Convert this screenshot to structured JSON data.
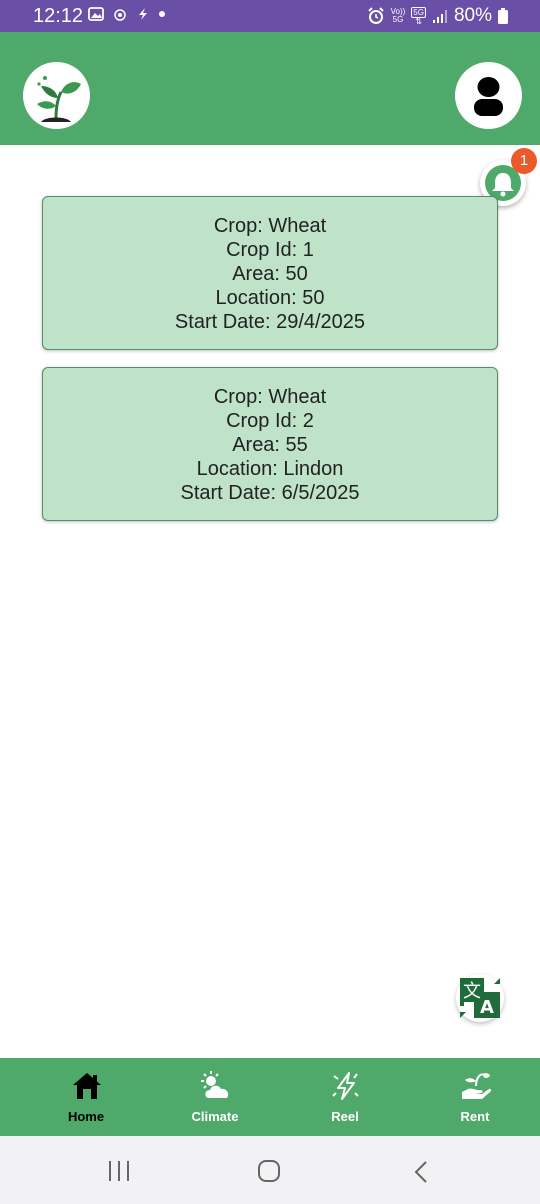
{
  "status_bar": {
    "time": "12:12",
    "network_top": "Vo))",
    "network_bottom": "5G",
    "network_badge": "5G",
    "battery_percent": "80%"
  },
  "header": {
    "logo_icon": "seedling-icon",
    "profile_icon": "user-icon"
  },
  "notifications": {
    "count": "1",
    "icon": "bell-icon"
  },
  "crops": [
    {
      "crop": "Crop: Wheat",
      "crop_id": "Crop Id: 1",
      "area": "Area: 50",
      "location": "Location: 50",
      "start_date": "Start Date: 29/4/2025"
    },
    {
      "crop": "Crop: Wheat",
      "crop_id": "Crop Id: 2",
      "area": "Area: 55",
      "location": "Location: Lindon",
      "start_date": "Start Date: 6/5/2025"
    }
  ],
  "translate": {
    "icon": "translate-icon",
    "glyph_a": "文",
    "glyph_b": "A"
  },
  "bottom_nav": {
    "home": "Home",
    "climate": "Climate",
    "reel": "Reel",
    "rent": "Rent"
  },
  "colors": {
    "primary_green": "#4ea96a",
    "card_green": "#bfe3c8",
    "status_purple": "#6a4fa6",
    "badge_orange": "#ec5a2c"
  }
}
